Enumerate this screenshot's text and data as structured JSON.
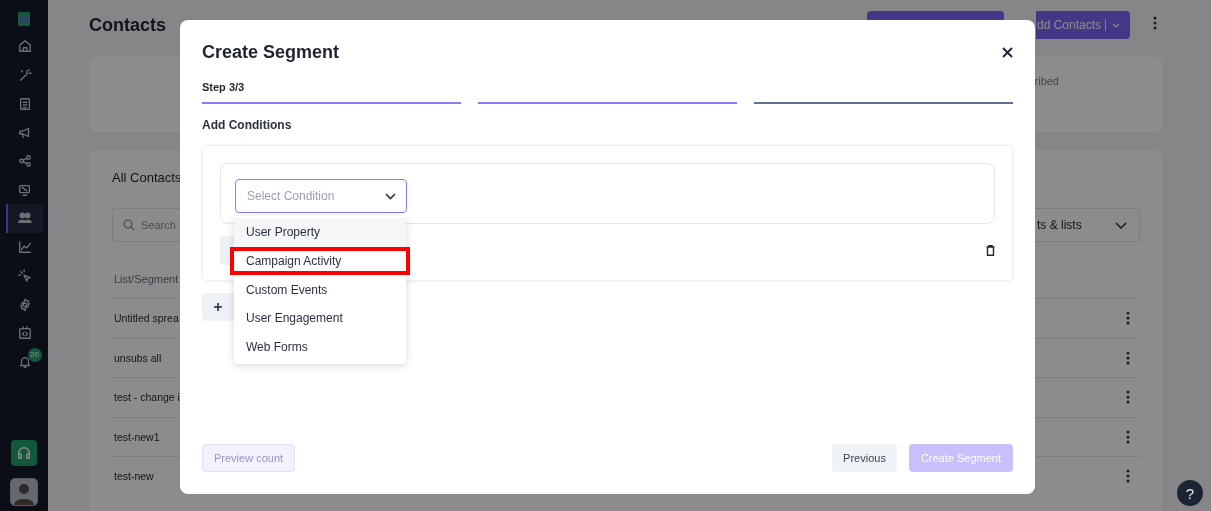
{
  "sidebar": {
    "items": [
      {
        "selected": false
      },
      {
        "selected": false
      },
      {
        "selected": false
      },
      {
        "selected": false
      },
      {
        "selected": false
      },
      {
        "selected": false
      },
      {
        "selected": true
      },
      {
        "selected": false
      },
      {
        "selected": false
      },
      {
        "selected": false
      },
      {
        "selected": false
      },
      {
        "selected": false
      }
    ],
    "notification_badge": "20"
  },
  "page": {
    "title": "Contacts",
    "add_button": "dd Contacts",
    "summary_text": "ribed",
    "list_title": "All Contacts",
    "search": {
      "placeholder": "Search"
    },
    "filter_dropdown": "ts & lists",
    "table": {
      "columns": [
        "List/Segment"
      ],
      "rows": [
        {
          "name": "Untitled sprea"
        },
        {
          "name": "unsubs all"
        },
        {
          "name": "test - change i"
        },
        {
          "name": "test-new1"
        },
        {
          "name": "test-new"
        }
      ]
    }
  },
  "modal": {
    "title": "Create Segment",
    "step": "Step 3/3",
    "progress": [
      {
        "complete": true
      },
      {
        "complete": true
      },
      {
        "complete": false
      }
    ],
    "section_title": "Add Conditions",
    "condition_select": {
      "placeholder": "Select Condition",
      "expanded": true
    },
    "options": [
      {
        "label": "User Property",
        "hovered": true,
        "highlighted": false
      },
      {
        "label": "Campaign Activity",
        "hovered": false,
        "highlighted": true
      },
      {
        "label": "Custom Events",
        "hovered": false,
        "highlighted": false
      },
      {
        "label": "User Engagement",
        "hovered": false,
        "highlighted": false
      },
      {
        "label": "Web Forms",
        "hovered": false,
        "highlighted": false
      }
    ],
    "buttons": {
      "preview": {
        "label": "Preview count",
        "disabled": true
      },
      "previous": {
        "label": "Previous",
        "disabled": false
      },
      "create": {
        "label": "Create Segment",
        "disabled": true
      }
    }
  },
  "help": "?"
}
